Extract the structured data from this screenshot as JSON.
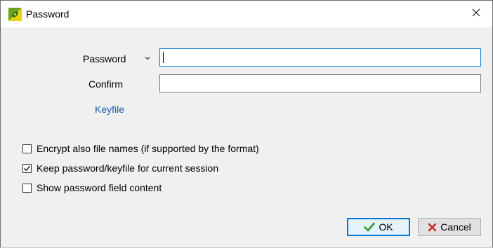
{
  "window": {
    "title": "Password",
    "app_icon": "app-logo-icon",
    "close_icon": "close-icon"
  },
  "form": {
    "password_label": "Password",
    "password_dropdown_icon": "chevron-down-icon",
    "password_value": "",
    "confirm_label": "Confirm",
    "confirm_value": "",
    "keyfile_link": "Keyfile"
  },
  "options": [
    {
      "label": "Encrypt also file names (if supported by the format)",
      "checked": false
    },
    {
      "label": "Keep password/keyfile for current session",
      "checked": true
    },
    {
      "label": "Show password field content",
      "checked": false
    }
  ],
  "buttons": {
    "ok_label": "OK",
    "ok_icon": "check-icon",
    "cancel_label": "Cancel",
    "cancel_icon": "x-icon"
  },
  "colors": {
    "accent": "#0078d7",
    "link": "#1a5fb4",
    "ok_check": "#2e9e2e",
    "cancel_x": "#cc2222"
  }
}
